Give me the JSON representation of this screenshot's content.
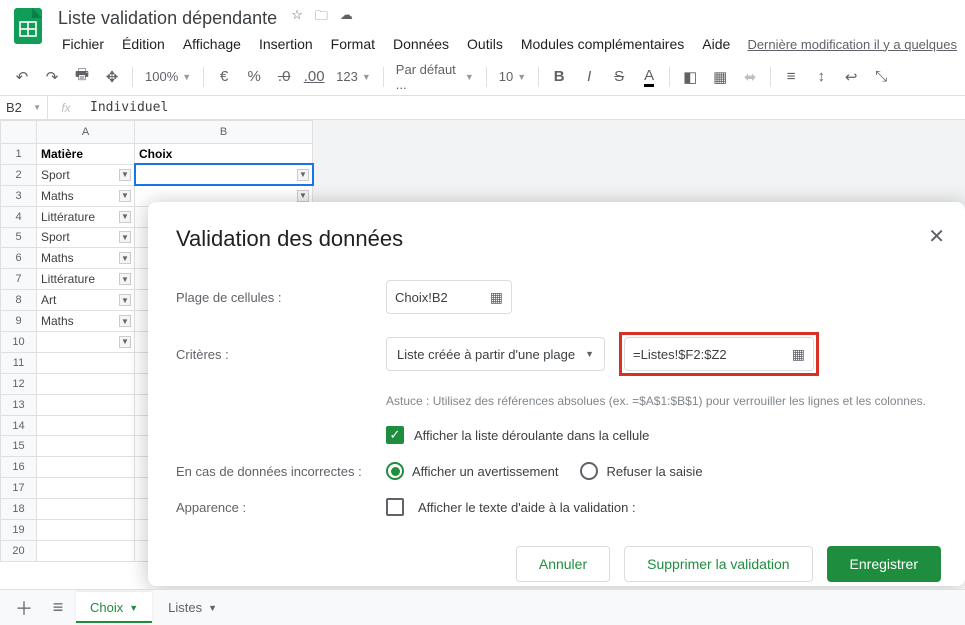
{
  "header": {
    "doc_title": "Liste validation dépendante",
    "last_modified": "Dernière modification il y a quelques"
  },
  "menu": [
    "Fichier",
    "Édition",
    "Affichage",
    "Insertion",
    "Format",
    "Données",
    "Outils",
    "Modules complémentaires",
    "Aide"
  ],
  "toolbar": {
    "zoom": "100%",
    "currency": "€",
    "percent": "%",
    "dec_dec": ".0",
    "dec_inc": ".00",
    "format_123": "123",
    "font": "Par défaut ...",
    "font_size": "10"
  },
  "formula_bar": {
    "name_box": "B2",
    "fx": "fx",
    "value": "Individuel"
  },
  "grid": {
    "col_headers": [
      "A",
      "B"
    ],
    "header_row": [
      "Matière",
      "Choix"
    ],
    "rows": [
      {
        "a": "Sport",
        "b": "",
        "selected": true
      },
      {
        "a": "Maths",
        "b": ""
      },
      {
        "a": "Littérature",
        "b": ""
      },
      {
        "a": "Sport",
        "b": ""
      },
      {
        "a": "Maths",
        "b": ""
      },
      {
        "a": "Littérature",
        "b": ""
      },
      {
        "a": "Art",
        "b": ""
      },
      {
        "a": "Maths",
        "b": ""
      }
    ]
  },
  "dialog": {
    "title": "Validation des données",
    "label_range": "Plage de cellules :",
    "range_value": "Choix!B2",
    "label_criteria": "Critères :",
    "criteria_select": "Liste créée à partir d'une plage",
    "criteria_value": "=Listes!$F2:$Z2",
    "hint": "Astuce : Utilisez des références absolues (ex. =$A$1:$B$1) pour verrouiller les lignes et les colonnes.",
    "chk_dropdown": "Afficher la liste déroulante dans la cellule",
    "label_invalid": "En cas de données incorrectes :",
    "radio_warn": "Afficher un avertissement",
    "radio_reject": "Refuser la saisie",
    "label_appearance": "Apparence :",
    "chk_help": "Afficher le texte d'aide à la validation :",
    "btn_cancel": "Annuler",
    "btn_remove": "Supprimer la validation",
    "btn_save": "Enregistrer"
  },
  "sheet_tabs": {
    "active": "Choix",
    "other": "Listes"
  }
}
